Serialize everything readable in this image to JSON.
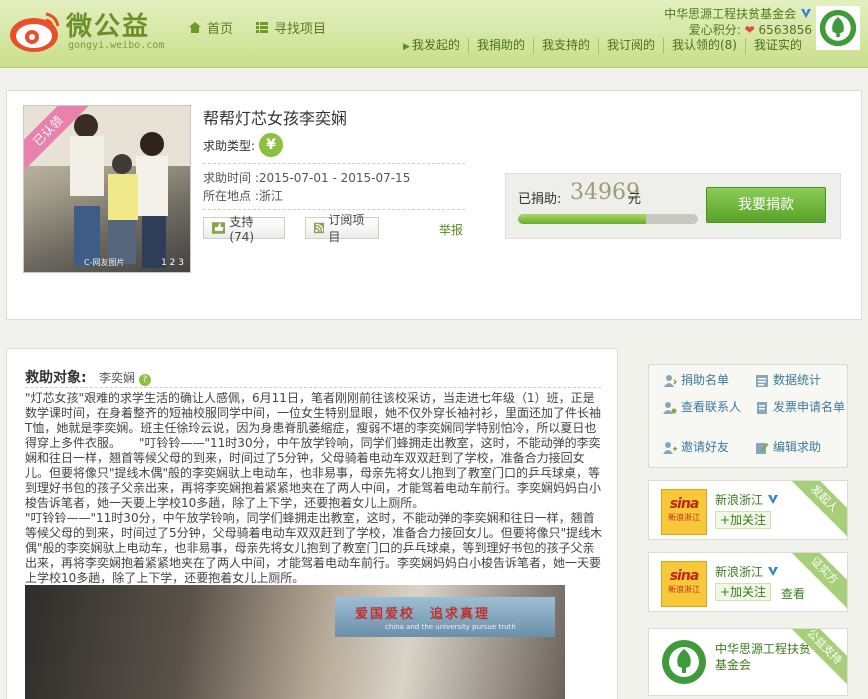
{
  "header": {
    "logo_text": "微公益",
    "logo_sub": "gongyi.weibo.com",
    "nav": [
      {
        "label": "首页"
      },
      {
        "label": "寻找项目"
      }
    ],
    "user": {
      "org_name": "中华思源工程扶贫基金会",
      "score_label": "爱心积分:",
      "score_value": "6563856"
    },
    "subnav": [
      {
        "label": "我发起的"
      },
      {
        "label": "我捐助的"
      },
      {
        "label": "我支持的"
      },
      {
        "label": "我订阅的"
      },
      {
        "label": "我认领的(8)"
      },
      {
        "label": "我证实的"
      }
    ]
  },
  "project": {
    "ribbon": "已认领",
    "title": "帮帮灯芯女孩李奕娴",
    "type_label": "求助类型:",
    "type_icon": "¥",
    "time_label": "求助时间",
    "time_value": ":2015-07-01 - 2015-07-15",
    "place_label": "所在地点",
    "place_value": ":浙江",
    "support_label": "支持(74)",
    "subscribe_label": "订阅项目",
    "report_label": "举报",
    "photo_pager": "1 2 3",
    "photo_credit": "C-网友图片",
    "donated_label": "已捐助:",
    "donated_amount": "34969",
    "donated_unit": "元",
    "progress_fraction": 0.71,
    "donate_button": "我要捐款"
  },
  "rescue": {
    "heading": "救助对象:",
    "name": "李奕娴",
    "paragraphs": [
      "\"灯芯女孩\"艰难的求学生活的确让人感佩，6月11日，笔者刚刚前往该校采访，当走进七年级（1）班，正是数学课时间，在身着整齐的短袖校服同学中间，一位女生特别显眼，她不仅外穿长袖衬衫，里面还加了件长袖T恤，她就是李奕娴。班主任徐玲云说，因为身患脊肌萎缩症，瘦弱不堪的李奕娴同学特别怕冷，所以夏日也得穿上多件衣服。　　\"叮铃铃——\"11时30分，中午放学铃响，同学们蜂拥走出教室，这时，不能动弹的李奕娴和往日一样，翘首等候父母的到来，时间过了5分钟，父母骑着电动车双双赶到了学校，准备合力接回女儿。但要将像只\"提线木偶\"般的李奕娴驮上电动车，也非易事，母亲先将女儿抱到了教室门口的乒乓球桌，等到理好书包的孩子父亲出来，再将李奕娴抱着紧紧地夹在了两人中间，才能驾着电动车前行。李奕娴妈妈白小梭告诉笔者，她一天要上学校10多趟，除了上下学，还要抱着女儿上厕所。",
      "\"叮铃铃——\"11时30分，中午放学铃响，同学们蜂拥走出教室，这时，不能动弹的李奕娴和往日一样，翘首等候父母的到来，时间过了5分钟，父母骑着电动车双双赶到了学校，准备合力接回女儿。但要将像只\"提线木偶\"般的李奕娴驮上电动车，也非易事，母亲先将女儿抱到了教室门口的乒乓球桌，等到理好书包的孩子父亲出来，再将李奕娴抱着紧紧地夹在了两人中间，才能驾着电动车前行。李奕娴妈妈白小梭告诉笔者，她一天要上学校10多趟，除了上下学，还要抱着女儿上厕所。"
    ],
    "banner_text": "爱国爱校　追求真理",
    "banner_sub": "china and the university pursue truth"
  },
  "sidebar": {
    "links": [
      {
        "label": "捐助名单"
      },
      {
        "label": "数据统计"
      },
      {
        "label": "查看联系人"
      },
      {
        "label": "发票申请名单"
      },
      {
        "label": "邀请好友"
      },
      {
        "label": "编辑求助"
      }
    ],
    "partners": [
      {
        "name": "新浪浙江",
        "logo_big": "sina",
        "logo_small": "新浪浙江",
        "follow": "+加关注",
        "view": "",
        "corner": "发起人"
      },
      {
        "name": "新浪浙江",
        "logo_big": "sina",
        "logo_small": "新浪浙江",
        "follow": "+加关注",
        "view": "查看",
        "corner": "证实方"
      },
      {
        "name": "中华思源工程扶贫基金会",
        "corner": "公益支持"
      }
    ]
  }
}
